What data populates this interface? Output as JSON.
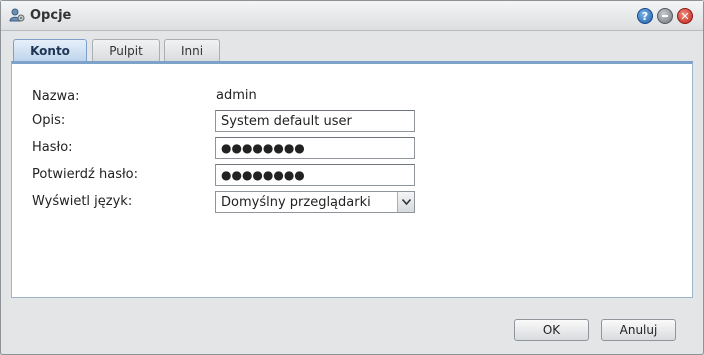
{
  "window": {
    "title": "Opcje",
    "icons": {
      "app": "user-settings-icon",
      "help": "help-icon",
      "minimize": "minimize-icon",
      "close": "close-icon"
    },
    "help_glyph": "?",
    "close_glyph": "✕"
  },
  "tabs": [
    {
      "label": "Konto",
      "active": true
    },
    {
      "label": "Pulpit",
      "active": false
    },
    {
      "label": "Inni",
      "active": false
    }
  ],
  "form": {
    "name": {
      "label": "Nazwa:",
      "value": "admin"
    },
    "description": {
      "label": "Opis:",
      "value": "System default user"
    },
    "password": {
      "label": "Hasło:",
      "value": "●●●●●●●●"
    },
    "confirm_password": {
      "label": "Potwierdź hasło:",
      "value": "●●●●●●●●"
    },
    "language": {
      "label": "Wyświetl język:",
      "selected": "Domyślny przeglądarki"
    }
  },
  "footer": {
    "ok_label": "OK",
    "cancel_label": "Anuluj"
  },
  "colors": {
    "accent": "#7ea3cb",
    "help": "#1f5ea8",
    "close": "#c02419"
  }
}
